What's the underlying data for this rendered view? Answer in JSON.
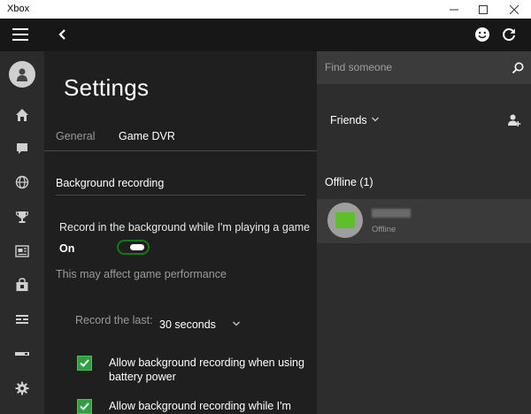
{
  "window": {
    "title": "Xbox"
  },
  "settings": {
    "title": "Settings",
    "tabs": [
      {
        "label": "General",
        "active": false
      },
      {
        "label": "Game DVR",
        "active": true
      }
    ],
    "section_title": "Background recording",
    "background_toggle": {
      "label": "Record in the background while I'm playing a game",
      "state_label": "On",
      "on": true
    },
    "performance_note": "This may affect game performance",
    "record_last": {
      "label": "Record the last:",
      "selected": "30 seconds"
    },
    "checkboxes": [
      {
        "label": "Allow background recording when using battery power",
        "checked": true
      },
      {
        "label": "Allow background recording while I'm using wireless display",
        "checked": true
      }
    ]
  },
  "friends_panel": {
    "search_placeholder": "Find someone",
    "filter_label": "Friends",
    "offline_header": "Offline (1)",
    "friends": [
      {
        "status": "Offline"
      }
    ]
  },
  "rail": {
    "icons": [
      "avatar-icon",
      "home-icon",
      "messages-icon",
      "globe-icon",
      "trophy-icon",
      "game-dvr-icon",
      "store-icon",
      "activity-feed-icon",
      "connection-icon",
      "settings-icon"
    ]
  },
  "colors": {
    "accent": "#107c10",
    "checkbox": "#2ea043",
    "background": "#1f1f1f",
    "rail": "#2b2b2b",
    "friends_panel": "#2d2d2d"
  }
}
